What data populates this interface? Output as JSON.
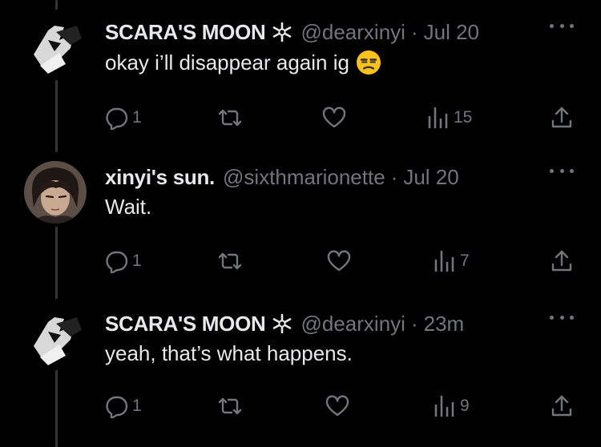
{
  "tweets": [
    {
      "display_name": "SCARA'S MOON",
      "handle": "@dearxinyi",
      "separator": "·",
      "time": "Jul 20",
      "text": "okay i’ll disappear again ig",
      "emoji": "unamused-face",
      "reply_count": "1",
      "retweet_count": "",
      "like_count": "",
      "views_count": "15"
    },
    {
      "display_name": "xinyi's sun.",
      "handle": "@sixthmarionette",
      "separator": "·",
      "time": "Jul 20",
      "text": "Wait.",
      "reply_count": "1",
      "retweet_count": "",
      "like_count": "",
      "views_count": "7"
    },
    {
      "display_name": "SCARA'S MOON",
      "handle": "@dearxinyi",
      "separator": "·",
      "time": "23m",
      "text": "yeah, that’s what happens.",
      "reply_count": "1",
      "retweet_count": "",
      "like_count": "",
      "views_count": "9"
    }
  ],
  "icons": {
    "verified_badge": "flower-badge-icon",
    "reply": "reply-icon",
    "retweet": "retweet-icon",
    "like": "heart-icon",
    "views": "views-icon",
    "share": "share-icon",
    "more": "more-icon"
  },
  "colors": {
    "background": "#000000",
    "text": "#e7e9ea",
    "muted": "#71767b",
    "thread_line": "#333639"
  }
}
